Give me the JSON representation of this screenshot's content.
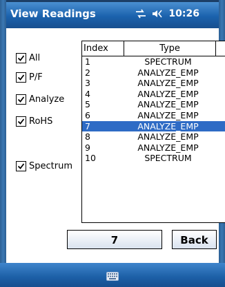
{
  "titlebar": {
    "title": "View Readings",
    "time": "10:26"
  },
  "filters": [
    {
      "label": "All",
      "checked": true
    },
    {
      "label": "P/F",
      "checked": true
    },
    {
      "label": "Analyze",
      "checked": true
    },
    {
      "label": "RoHS",
      "checked": true
    },
    {
      "label": "Spectrum",
      "checked": true
    }
  ],
  "list": {
    "columns": [
      "Index",
      "Type"
    ],
    "rows": [
      {
        "index": "1",
        "type": "SPECTRUM"
      },
      {
        "index": "2",
        "type": "ANALYZE_EMP"
      },
      {
        "index": "3",
        "type": "ANALYZE_EMP"
      },
      {
        "index": "4",
        "type": "ANALYZE_EMP"
      },
      {
        "index": "5",
        "type": "ANALYZE_EMP"
      },
      {
        "index": "6",
        "type": "ANALYZE_EMP"
      },
      {
        "index": "7",
        "type": "ANALYZE_EMP"
      },
      {
        "index": "8",
        "type": "ANALYZE_EMP"
      },
      {
        "index": "9",
        "type": "ANALYZE_EMP"
      },
      {
        "index": "10",
        "type": "SPECTRUM"
      }
    ],
    "selected_index": 6
  },
  "buttons": {
    "number_label": "7",
    "back_label": "Back"
  },
  "colors": {
    "titlebar": "#1b62ad",
    "selection": "#2e6bc5"
  },
  "icons": {
    "connectivity": "connectivity-icon",
    "volume": "volume-icon",
    "keyboard": "keyboard-icon"
  }
}
